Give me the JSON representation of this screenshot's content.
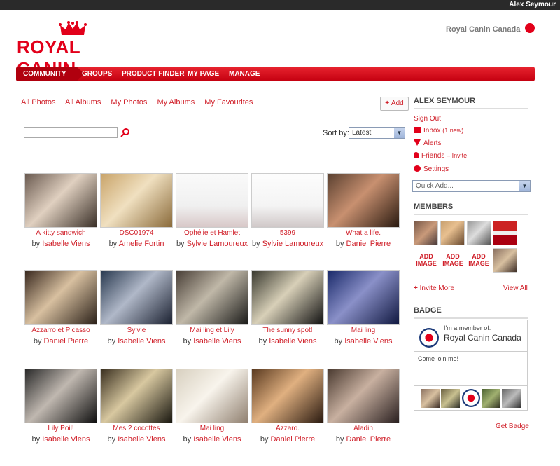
{
  "top": {
    "user": "Alex Seymour"
  },
  "brand": {
    "name": "ROYAL CANIN",
    "country": "Royal Canin Canada"
  },
  "nav": {
    "items": [
      "COMMUNITY",
      "GROUPS",
      "PRODUCT FINDER",
      "MY PAGE",
      "MANAGE"
    ]
  },
  "tabs": [
    "All Photos",
    "All Albums",
    "My Photos",
    "My Albums",
    "My Favourites"
  ],
  "add_label": "Add",
  "sort": {
    "label": "Sort by:",
    "value": "Latest"
  },
  "photos": [
    {
      "title": "A kitty sandwich",
      "author": "Isabelle Viens"
    },
    {
      "title": "DSC01974",
      "author": "Amelie Fortin"
    },
    {
      "title": "Ophélie et Hamlet",
      "author": "Sylvie Lamoureux"
    },
    {
      "title": "5399",
      "author": "Sylvie Lamoureux"
    },
    {
      "title": "What a life.",
      "author": "Daniel Pierre"
    },
    {
      "title": "Azzarro et Picasso",
      "author": "Daniel Pierre"
    },
    {
      "title": "Sylvie",
      "author": "Isabelle Viens"
    },
    {
      "title": "Mai ling et Lily",
      "author": "Isabelle Viens"
    },
    {
      "title": "The sunny spot!",
      "author": "Isabelle Viens"
    },
    {
      "title": "Mai ling",
      "author": "Isabelle Viens"
    },
    {
      "title": "Lily Poil!",
      "author": "Isabelle Viens"
    },
    {
      "title": "Mes 2 cocottes",
      "author": "Isabelle Viens"
    },
    {
      "title": "Mai ling",
      "author": "Isabelle Viens"
    },
    {
      "title": "Azzaro.",
      "author": "Daniel Pierre"
    },
    {
      "title": "Aladin",
      "author": "Daniel Pierre"
    }
  ],
  "by": "by",
  "sidebar": {
    "user": "ALEX SEYMOUR",
    "sign_out": "Sign Out",
    "inbox": "Inbox",
    "inbox_count": "(1 new)",
    "alerts": "Alerts",
    "friends": "Friends",
    "invite": "– Invite",
    "settings": "Settings",
    "quick_add": "Quick Add...",
    "members_title": "MEMBERS",
    "add_image": "ADD IMAGE",
    "invite_more": "Invite More",
    "view_all": "View All",
    "badge_title": "BADGE",
    "badge_member_of": "I'm a member of:",
    "badge_name": "Royal Canin Canada",
    "badge_join": "Come join me!",
    "get_badge": "Get Badge"
  }
}
